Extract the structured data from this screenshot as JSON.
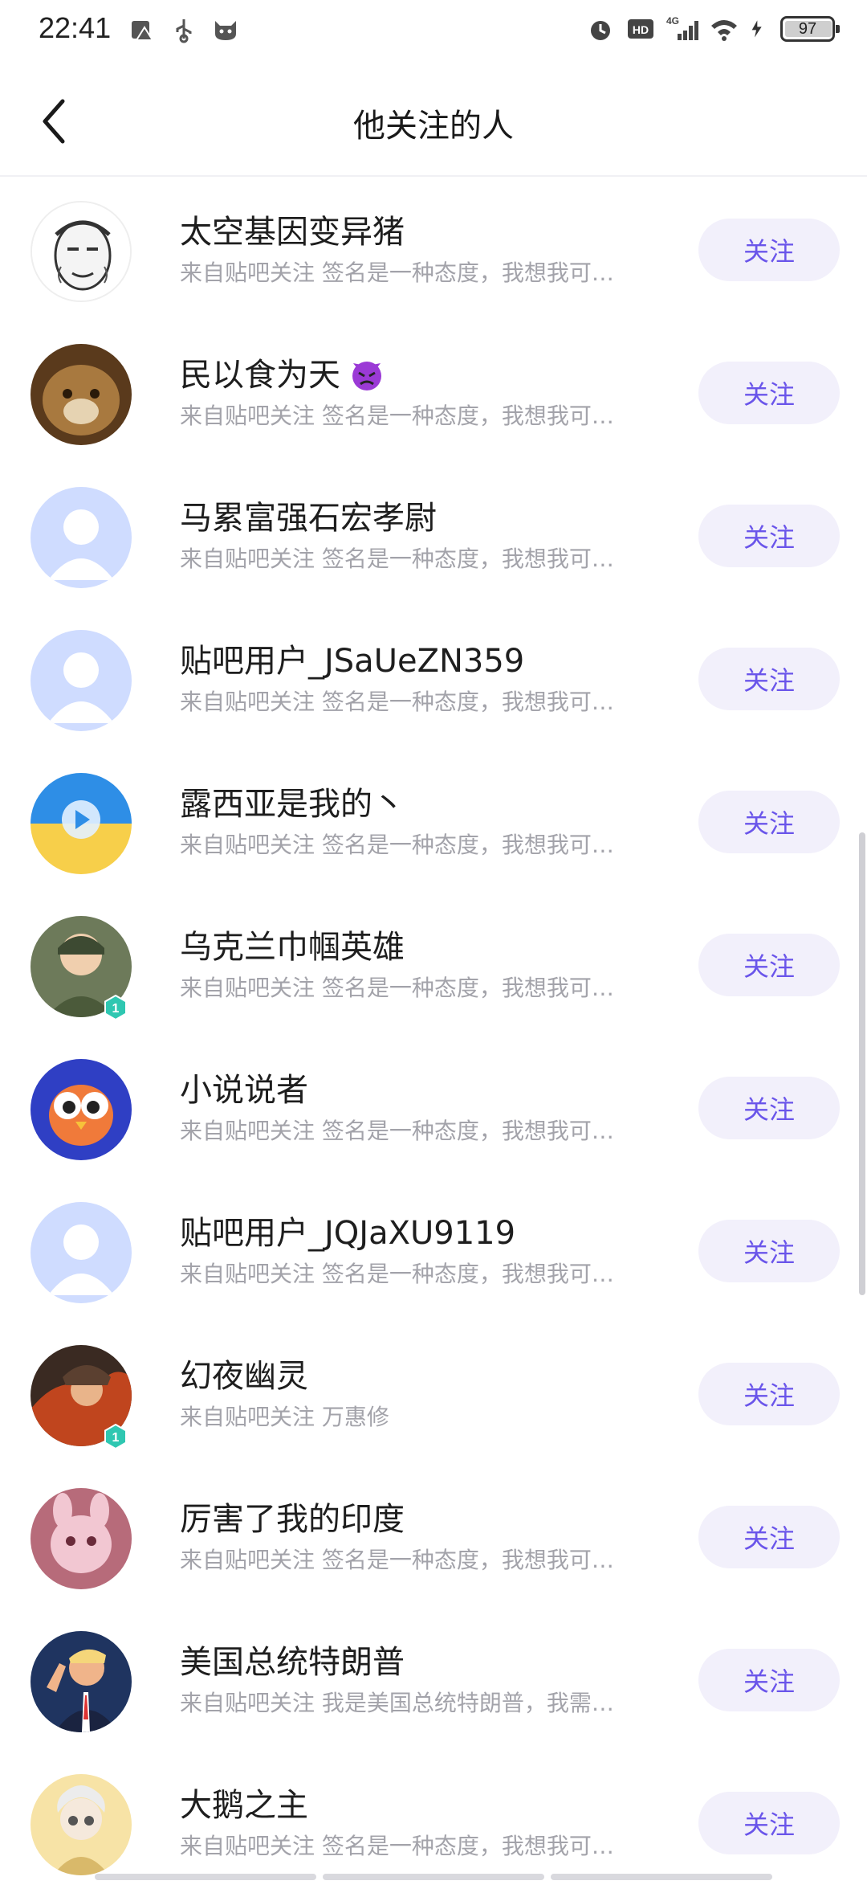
{
  "status_bar": {
    "time": "22:41",
    "battery": "97",
    "network": "4G",
    "hd": "HD"
  },
  "header": {
    "title": "他关注的人"
  },
  "users": [
    {
      "name": "太空基因变异猪",
      "desc": "来自贴吧关注 签名是一种态度，我想我可…",
      "follow": "关注"
    },
    {
      "name": "民以食为天",
      "desc": "来自贴吧关注 签名是一种态度，我想我可…",
      "follow": "关注"
    },
    {
      "name": "马累富强石宏孝尉",
      "desc": "来自贴吧关注 签名是一种态度，我想我可…",
      "follow": "关注"
    },
    {
      "name": "贴吧用户_JSaUeZN359",
      "desc": "来自贴吧关注 签名是一种态度，我想我可…",
      "follow": "关注"
    },
    {
      "name": "露西亚是我的丶",
      "desc": "来自贴吧关注 签名是一种态度，我想我可…",
      "follow": "关注"
    },
    {
      "name": "乌克兰巾帼英雄",
      "desc": "来自贴吧关注 签名是一种态度，我想我可…",
      "follow": "关注"
    },
    {
      "name": "小说说者",
      "desc": "来自贴吧关注 签名是一种态度，我想我可…",
      "follow": "关注"
    },
    {
      "name": "贴吧用户_JQJaXU9119",
      "desc": "来自贴吧关注 签名是一种态度，我想我可…",
      "follow": "关注"
    },
    {
      "name": "幻夜幽灵",
      "desc": "来自贴吧关注 万惠修",
      "follow": "关注"
    },
    {
      "name": "厉害了我的印度",
      "desc": "来自贴吧关注 签名是一种态度，我想我可…",
      "follow": "关注"
    },
    {
      "name": "美国总统特朗普",
      "desc": "来自贴吧关注 我是美国总统特朗普，我需…",
      "follow": "关注"
    },
    {
      "name": "大鹅之主",
      "desc": "来自贴吧关注 签名是一种态度，我想我可…",
      "follow": "关注"
    }
  ],
  "badge_level": "1",
  "colors": {
    "accent": "#6a55ea",
    "button_bg": "#f2f0fb",
    "secondary_text": "#a3a3aa"
  }
}
